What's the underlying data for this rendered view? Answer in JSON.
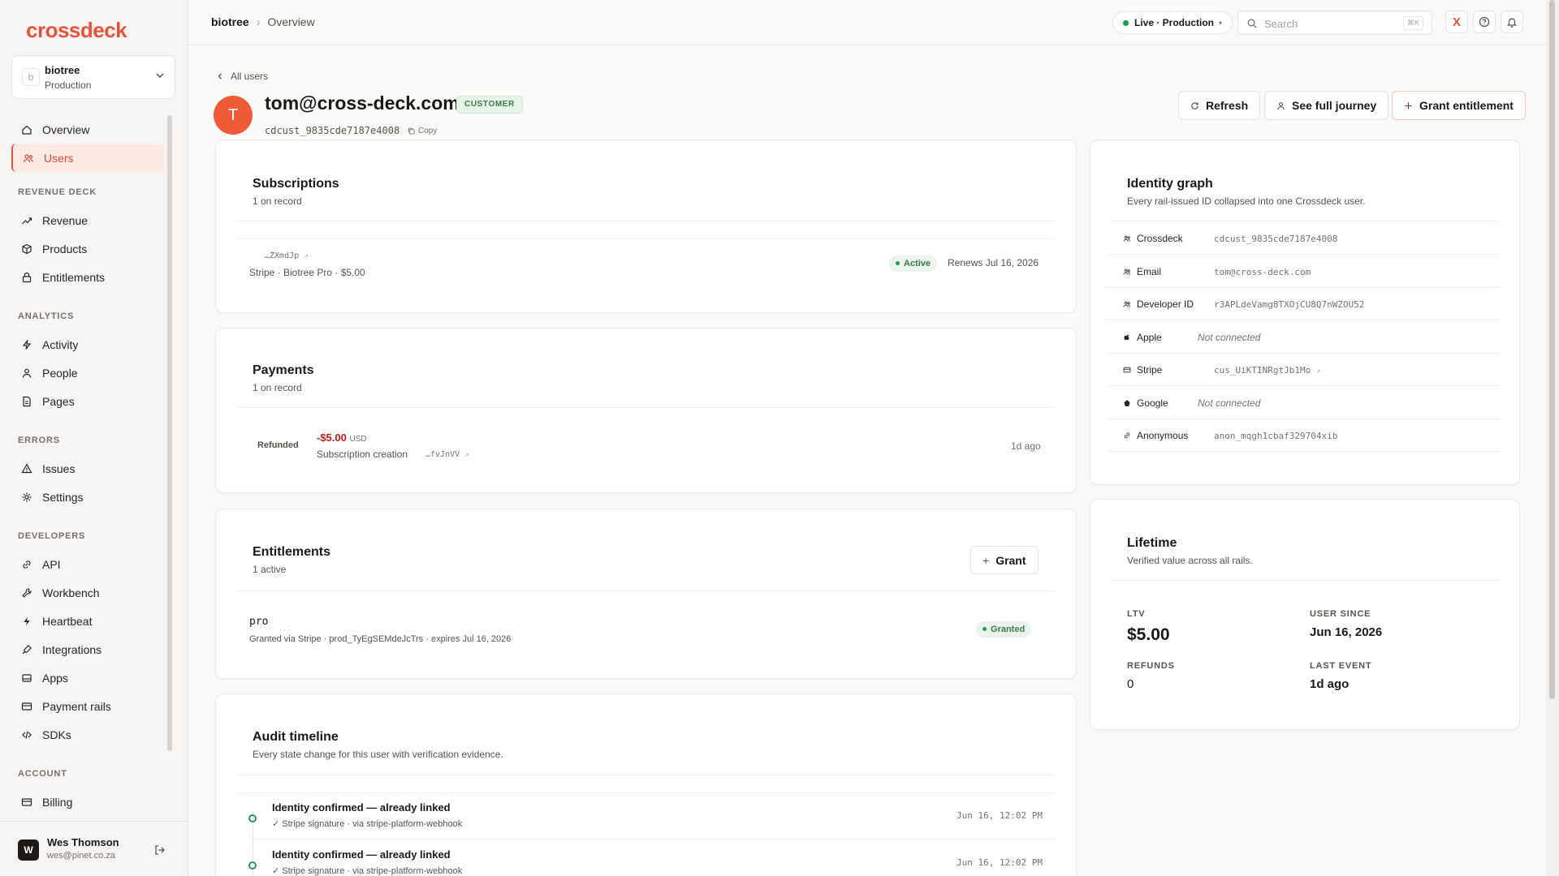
{
  "app": {
    "logo": "crossdeck"
  },
  "workspace": {
    "name": "biotree",
    "env": "Production",
    "initial": "b"
  },
  "sidebar": {
    "top": [
      {
        "label": "Overview",
        "icon": "home-icon"
      },
      {
        "label": "Users",
        "icon": "users-icon",
        "active": true
      }
    ],
    "sections": [
      {
        "title": "REVENUE DECK",
        "items": [
          {
            "label": "Revenue",
            "icon": "trend-icon"
          },
          {
            "label": "Products",
            "icon": "box-icon"
          },
          {
            "label": "Entitlements",
            "icon": "lock-icon"
          }
        ]
      },
      {
        "title": "ANALYTICS",
        "items": [
          {
            "label": "Activity",
            "icon": "bolt-icon"
          },
          {
            "label": "People",
            "icon": "person-icon"
          },
          {
            "label": "Pages",
            "icon": "page-icon"
          }
        ]
      },
      {
        "title": "ERRORS",
        "items": [
          {
            "label": "Issues",
            "icon": "warning-icon"
          },
          {
            "label": "Settings",
            "icon": "gear-icon"
          }
        ]
      },
      {
        "title": "DEVELOPERS",
        "items": [
          {
            "label": "API",
            "icon": "link-icon"
          },
          {
            "label": "Workbench",
            "icon": "wrench-icon"
          },
          {
            "label": "Heartbeat",
            "icon": "pulse-icon"
          },
          {
            "label": "Integrations",
            "icon": "plug-icon"
          },
          {
            "label": "Apps",
            "icon": "apps-icon"
          },
          {
            "label": "Payment rails",
            "icon": "card-icon"
          },
          {
            "label": "SDKs",
            "icon": "code-icon"
          }
        ]
      },
      {
        "title": "ACCOUNT",
        "items": [
          {
            "label": "Billing",
            "icon": "card-icon"
          }
        ]
      }
    ]
  },
  "current_user": {
    "initial": "W",
    "name": "Wes Thomson",
    "email": "wes@pinet.co.za"
  },
  "topbar": {
    "breadcrumb": [
      "biotree",
      "Overview"
    ],
    "env_label": "Live · Production",
    "search_placeholder": "Search",
    "search_shortcut": "⌘K",
    "x_label": "X"
  },
  "user": {
    "back_label": "All users",
    "initial": "T",
    "email": "tom@cross-deck.com",
    "badge": "CUSTOMER",
    "id": "cdcust_9835cde7187e4008",
    "copy_label": "Copy"
  },
  "actions": {
    "refresh": "Refresh",
    "journey": "See full journey",
    "grant_entitlement": "Grant entitlement"
  },
  "subscriptions": {
    "title": "Subscriptions",
    "count": "1 on record",
    "item": {
      "ref": "…ZXmdJp",
      "desc": "Stripe · Biotree Pro · $5.00",
      "status": "Active",
      "renews": "Renews Jul 16, 2026"
    }
  },
  "payments": {
    "title": "Payments",
    "count": "1 on record",
    "item": {
      "status": "Refunded",
      "amount": "-$5.00",
      "currency": "USD",
      "desc": "Subscription creation",
      "ref": "…fvJnVV",
      "when": "1d ago"
    }
  },
  "entitlements": {
    "title": "Entitlements",
    "count": "1 active",
    "grant_label": "Grant",
    "item": {
      "name": "pro",
      "desc": "Granted via Stripe · prod_TyEgSEMdeJcTrs · expires Jul 16, 2026",
      "status": "Granted"
    }
  },
  "audit": {
    "title": "Audit timeline",
    "subtitle": "Every state change for this user with verification evidence.",
    "events": [
      {
        "title": "Identity confirmed — already linked",
        "sub": "✓ Stripe signature · via stripe-platform-webhook",
        "time": "Jun 16, 12:02 PM"
      },
      {
        "title": "Identity confirmed — already linked",
        "sub": "✓ Stripe signature · via stripe-platform-webhook",
        "time": "Jun 16, 12:02 PM"
      }
    ]
  },
  "identity": {
    "title": "Identity graph",
    "subtitle": "Every rail-issued ID collapsed into one Crossdeck user.",
    "rows": [
      {
        "label": "Crossdeck",
        "value": "cdcust_9835cde7187e4008",
        "icon": "users-icon"
      },
      {
        "label": "Email",
        "value": "tom@cross-deck.com",
        "icon": "users-icon"
      },
      {
        "label": "Developer ID",
        "value": "r3APLdeVamg8TXOjCU8Q7nWZOU52",
        "icon": "users-icon"
      },
      {
        "label": "Apple",
        "value": "Not connected",
        "icon": "apple-icon",
        "nc": true
      },
      {
        "label": "Stripe",
        "value": "cus_UiKTINRgtJb1Mo",
        "icon": "card-icon",
        "ext": true
      },
      {
        "label": "Google",
        "value": "Not connected",
        "icon": "google-icon",
        "nc": true
      },
      {
        "label": "Anonymous",
        "value": "anon_mqgh1cbaf329704xib",
        "icon": "link-icon"
      }
    ]
  },
  "lifetime": {
    "title": "Lifetime",
    "subtitle": "Verified value across all rails.",
    "ltv_label": "LTV",
    "ltv": "$5.00",
    "since_label": "USER SINCE",
    "since": "Jun 16, 2026",
    "refunds_label": "REFUNDS",
    "refunds": "0",
    "last_label": "LAST EVENT",
    "last": "1d ago"
  }
}
